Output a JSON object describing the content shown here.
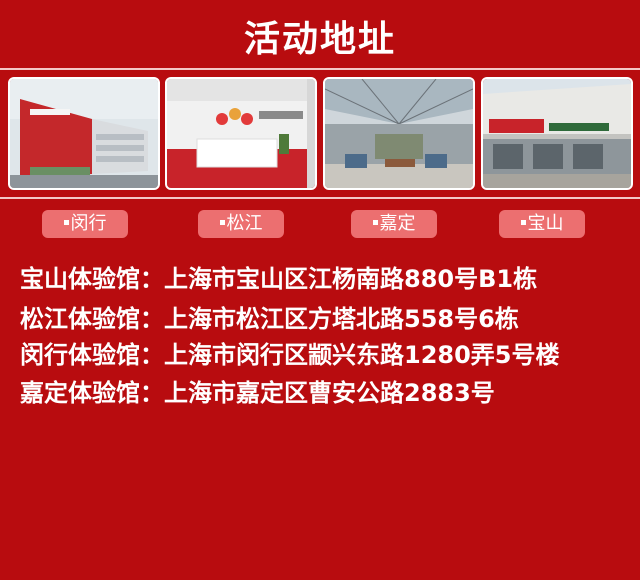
{
  "title": "活动地址",
  "tags": [
    {
      "label": "闵行"
    },
    {
      "label": "松江"
    },
    {
      "label": "嘉定"
    },
    {
      "label": "宝山"
    }
  ],
  "addresses": [
    {
      "text": "宝山体验馆：上海市宝山区江杨南路880号B1栋"
    },
    {
      "text": "松江体验馆：上海市松江区方塔北路558号6栋"
    },
    {
      "text": "闵行体验馆：上海市闵行区颛兴东路1280弄5号楼"
    },
    {
      "text": "嘉定体验馆：上海市嘉定区曹安公路2883号"
    }
  ],
  "colors": {
    "background": "#b80c0f",
    "tag": "#ec6f70",
    "text": "#ffffff"
  }
}
